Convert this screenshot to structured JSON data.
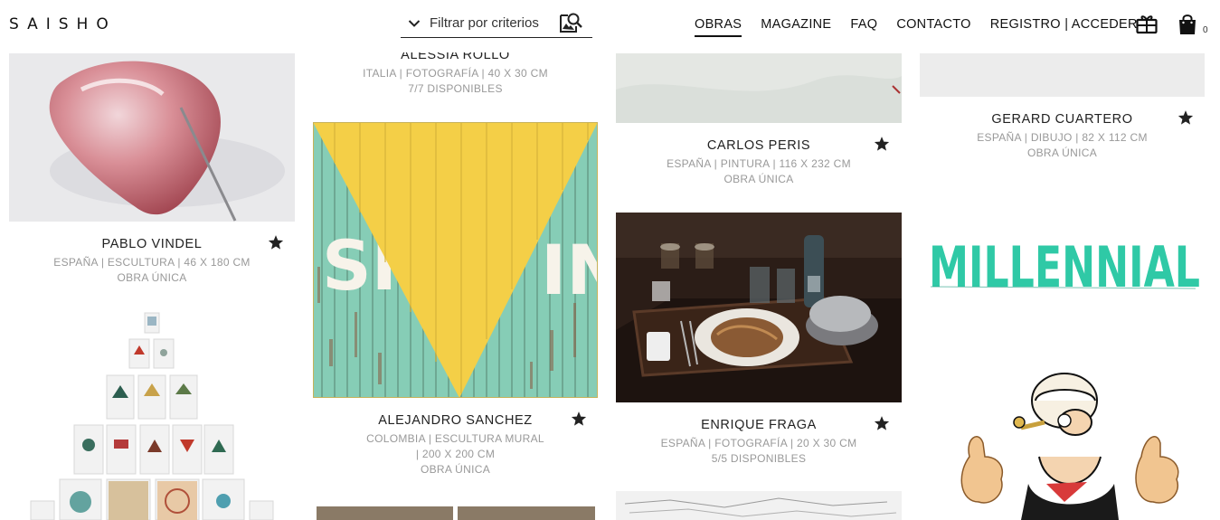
{
  "header": {
    "logo": "SAISHO",
    "filter_label": "Filtrar por criterios",
    "nav": [
      "OBRAS",
      "MAGAZINE",
      "FAQ",
      "CONTACTO",
      "REGISTRO | ACCEDER"
    ],
    "cart_count": "0"
  },
  "works": [
    {
      "artist": "PABLO VINDEL",
      "meta": "ESPAÑA   |   ESCULTURA   |   46 X 180 CM",
      "avail": "OBRA ÚNICA"
    },
    {
      "artist": "ALESSIA ROLLO",
      "meta": "ITALIA   |   FOTOGRAFÍA   |   40 X 30 CM",
      "avail": "7/7 DISPONIBLES"
    },
    {
      "artist": "ALEJANDRO SANCHEZ",
      "meta": "COLOMBIA   |   ESCULTURA MURAL",
      "meta2": "|   200 X 200 CM",
      "avail": "OBRA ÚNICA"
    },
    {
      "artist": "CARLOS PERIS",
      "meta": "ESPAÑA   |   PINTURA   |   116 X 232 CM",
      "avail": "OBRA ÚNICA"
    },
    {
      "artist": "ENRIQUE FRAGA",
      "meta": "ESPAÑA   |   FOTOGRAFÍA   |   20 X 30 CM",
      "avail": "5/5 DISPONIBLES"
    },
    {
      "artist": "GERARD CUARTERO",
      "meta": "ESPAÑA   |   DIBUJO   |   82 X 112 CM",
      "avail": "OBRA ÚNICA"
    }
  ],
  "artwork_text": {
    "sign_left": "SH",
    "sign_right": "IN",
    "millennial": "MILLENNIAL"
  }
}
